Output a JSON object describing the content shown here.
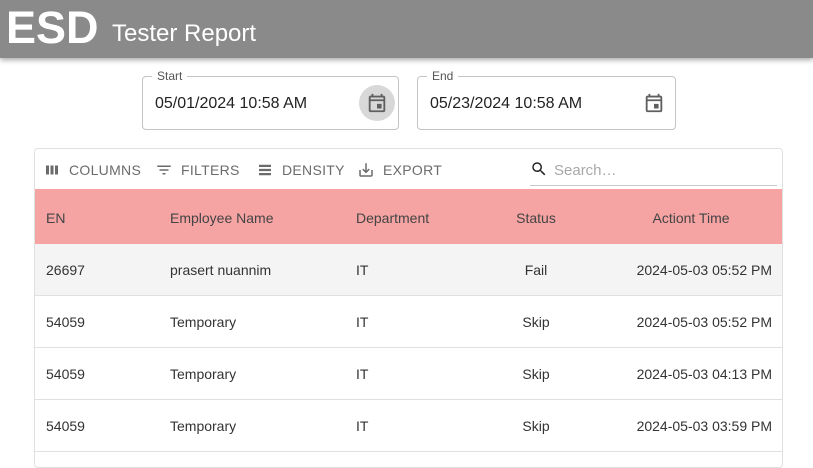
{
  "header": {
    "brand": "ESD",
    "title": "Tester Report"
  },
  "filters": {
    "start": {
      "label": "Start",
      "value": "05/01/2024 10:58 AM"
    },
    "end": {
      "label": "End",
      "value": "05/23/2024 10:58 AM"
    }
  },
  "toolbar": {
    "columns": "COLUMNS",
    "filters": "FILTERS",
    "density": "DENSITY",
    "export": "EXPORT",
    "search_placeholder": "Search…"
  },
  "table": {
    "columns": [
      "EN",
      "Employee Name",
      "Department",
      "Status",
      "Actiont Time"
    ],
    "rows": [
      [
        "26697",
        "prasert nuannim",
        "IT",
        "Fail",
        "2024-05-03 05:52 PM"
      ],
      [
        "54059",
        "Temporary",
        "IT",
        "Skip",
        "2024-05-03 05:52 PM"
      ],
      [
        "54059",
        "Temporary",
        "IT",
        "Skip",
        "2024-05-03 04:13 PM"
      ],
      [
        "54059",
        "Temporary",
        "IT",
        "Skip",
        "2024-05-03 03:59 PM"
      ]
    ]
  },
  "colors": {
    "header_bg": "#8a8a8a",
    "table_header_bg": "#f5a3a3"
  },
  "icons": [
    "calendar-icon",
    "columns-icon",
    "filter-icon",
    "density-icon",
    "export-icon",
    "search-icon"
  ]
}
